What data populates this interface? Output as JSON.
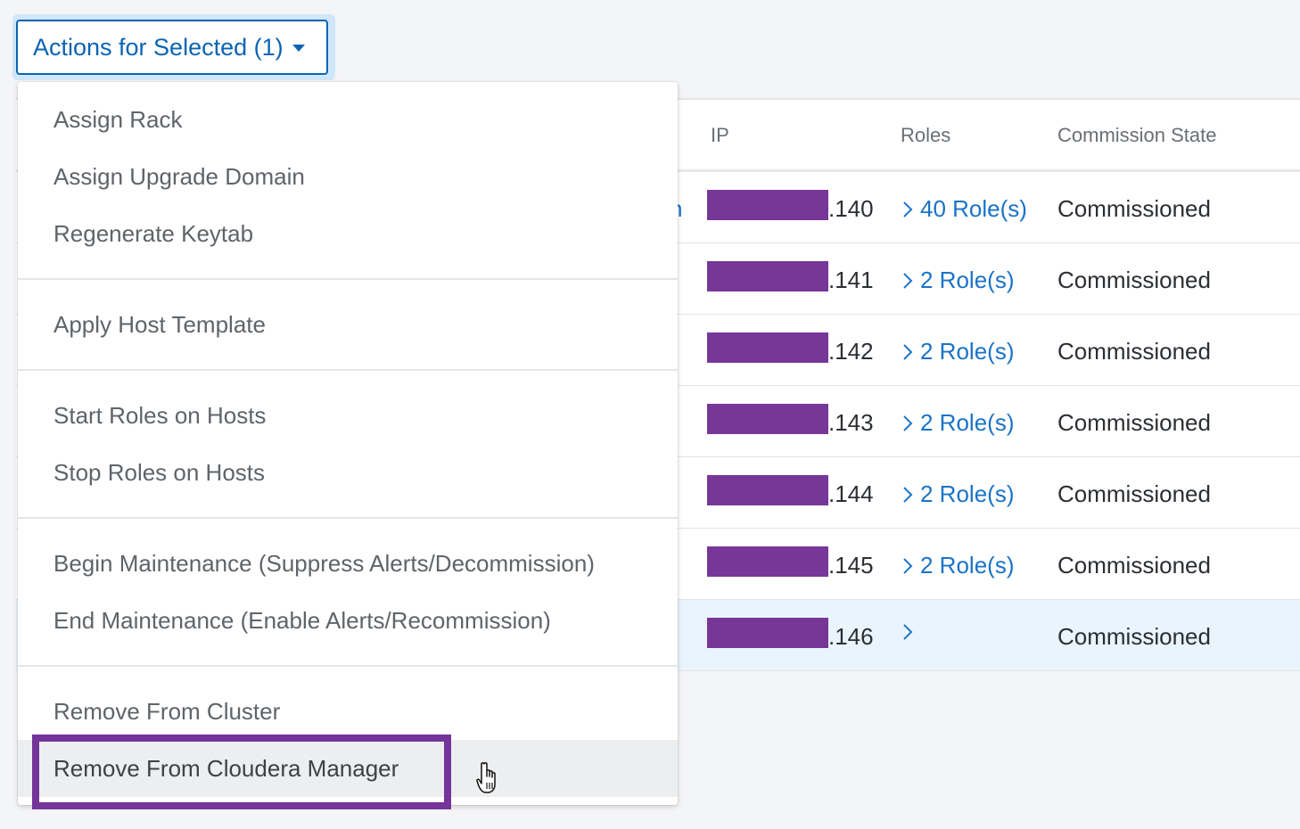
{
  "actions_button": {
    "label": "Actions for Selected (1)",
    "icon": "caret-down-icon"
  },
  "menu": {
    "items": [
      {
        "label": "Assign Rack"
      },
      {
        "label": "Assign Upgrade Domain"
      },
      {
        "label": "Regenerate Keytab"
      },
      {
        "label": "Apply Host Template"
      },
      {
        "label": "Start Roles on Hosts"
      },
      {
        "label": "Stop Roles on Hosts"
      },
      {
        "label": "Begin Maintenance (Suppress Alerts/Decommission)"
      },
      {
        "label": "End Maintenance (Enable Alerts/Recommission)"
      },
      {
        "label": "Remove From Cluster"
      },
      {
        "label": "Remove From Cloudera Manager",
        "hovered": true
      }
    ]
  },
  "table": {
    "headers": {
      "ip": "IP",
      "roles": "Roles",
      "commission_state": "Commission State"
    },
    "first_row_name_fragment": "n",
    "rows": [
      {
        "ip_suffix": ".140",
        "roles": "40 Role(s)",
        "state": "Commissioned",
        "selected": false
      },
      {
        "ip_suffix": ".141",
        "roles": "2 Role(s)",
        "state": "Commissioned",
        "selected": false
      },
      {
        "ip_suffix": ".142",
        "roles": "2 Role(s)",
        "state": "Commissioned",
        "selected": false
      },
      {
        "ip_suffix": ".143",
        "roles": "2 Role(s)",
        "state": "Commissioned",
        "selected": false
      },
      {
        "ip_suffix": ".144",
        "roles": "2 Role(s)",
        "state": "Commissioned",
        "selected": false
      },
      {
        "ip_suffix": ".145",
        "roles": "2 Role(s)",
        "state": "Commissioned",
        "selected": false
      },
      {
        "ip_suffix": ".146",
        "roles": "",
        "state": "Commissioned",
        "selected": true
      }
    ]
  },
  "colors": {
    "accent": "#0a64b4",
    "link": "#1a73c7",
    "redaction": "#783699",
    "highlight_border": "#74349a",
    "selected_row": "#eaf4fc"
  }
}
